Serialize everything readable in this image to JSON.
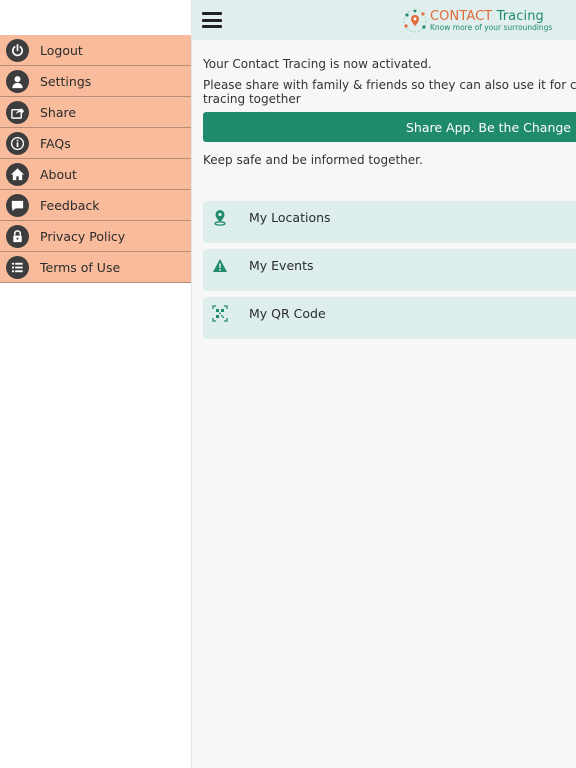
{
  "colors": {
    "menu_bg": "#f8bc9c",
    "menu_icon_bg": "#3d3d3d",
    "header_bg": "#e0efed",
    "accent": "#1f8a6c",
    "card_bg": "#deeeec",
    "logo_orange": "#e06a3a"
  },
  "header": {
    "logo_title_a": "CONTACT",
    "logo_title_b": "Tracing",
    "logo_tagline": "Know more of your surroundings"
  },
  "drawer": {
    "items": [
      {
        "label": "Logout",
        "icon": "power-icon"
      },
      {
        "label": "Settings",
        "icon": "user-icon"
      },
      {
        "label": "Share",
        "icon": "share-icon"
      },
      {
        "label": "FAQs",
        "icon": "info-icon"
      },
      {
        "label": "About",
        "icon": "home-icon"
      },
      {
        "label": "Feedback",
        "icon": "chat-icon"
      },
      {
        "label": "Privacy Policy",
        "icon": "lock-icon"
      },
      {
        "label": "Terms of Use",
        "icon": "list-icon"
      }
    ]
  },
  "main": {
    "activated_text": "Your Contact Tracing is now activated.",
    "share_text": "Please share with family & friends so they can also use it for contact tracing together",
    "share_button": "Share App. Be the Change",
    "safe_text": "Keep safe and be informed together.",
    "cards": [
      {
        "label": "My Locations",
        "icon": "location-pin-icon"
      },
      {
        "label": "My Events",
        "icon": "warning-icon"
      },
      {
        "label": "My QR Code",
        "icon": "qr-code-icon"
      }
    ]
  }
}
